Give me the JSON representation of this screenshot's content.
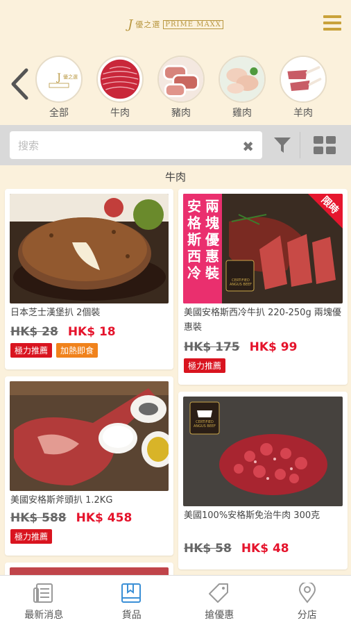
{
  "header": {
    "logo_mark": "J",
    "logo_cn": "優之選",
    "logo_en": "PRIME MAXX"
  },
  "categories": [
    {
      "label": "全部"
    },
    {
      "label": "牛肉"
    },
    {
      "label": "豬肉"
    },
    {
      "label": "雞肉"
    },
    {
      "label": "羊肉"
    }
  ],
  "search": {
    "placeholder": "搜索"
  },
  "section_title": "牛肉",
  "products": [
    {
      "title": "日本芝士漢堡扒 2個裝",
      "old_price": "HK$ 28",
      "new_price": "HK$ 18",
      "tags": [
        "極力推薦",
        "加熱即食"
      ]
    },
    {
      "title": "美國安格斯西冷牛扒 220-250g 兩塊優惠裝",
      "old_price": "HK$ 175",
      "new_price": "HK$ 99",
      "tags": [
        "極力推薦"
      ],
      "banner": "安格斯西冷",
      "banner2": "兩塊優惠裝",
      "corner": "限時",
      "badge": "CERTIFIED ANGUS BEEF"
    },
    {
      "title": "美國安格斯斧頭扒 1.2KG",
      "old_price": "HK$ 588",
      "new_price": "HK$ 458",
      "tags": [
        "極力推薦"
      ]
    },
    {
      "title": "美國100%安格斯免治牛肉 300克",
      "old_price": "HK$ 58",
      "new_price": "HK$ 48",
      "tags": [],
      "badge": "CERTIFIED ANGUS BEEF"
    }
  ],
  "nav": [
    {
      "label": "最新消息"
    },
    {
      "label": "貨品"
    },
    {
      "label": "搶優惠"
    },
    {
      "label": "分店"
    }
  ],
  "colors": {
    "accent": "#c9a23a",
    "price_red": "#e5132b",
    "tag_red": "#d9141f",
    "tag_orange": "#f0821c",
    "bg": "#fbf1dc"
  }
}
